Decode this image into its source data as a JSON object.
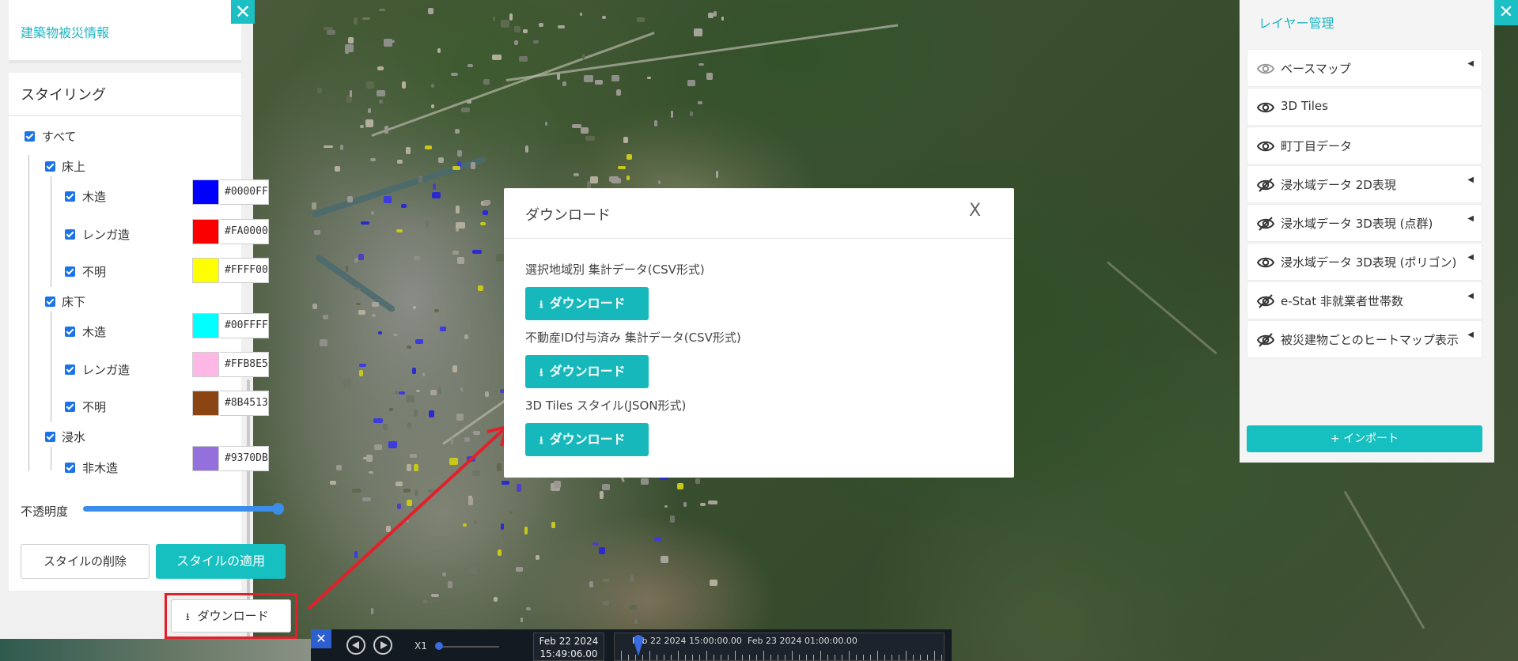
{
  "left_panel": {
    "title": "建築物被災情報",
    "close_symbol": "✕",
    "styling": {
      "title": "スタイリング",
      "all_label": "すべて",
      "groups": [
        {
          "label": "床上",
          "items": [
            {
              "label": "木造",
              "color": "#0000FF"
            },
            {
              "label": "レンガ造",
              "color": "#FA0000"
            },
            {
              "label": "不明",
              "color": "#FFFF00"
            }
          ]
        },
        {
          "label": "床下",
          "items": [
            {
              "label": "木造",
              "color": "#00FFFF"
            },
            {
              "label": "レンガ造",
              "color": "#FFB8E5"
            },
            {
              "label": "不明",
              "color": "#8B4513"
            }
          ]
        },
        {
          "label": "浸水",
          "items": [
            {
              "label": "非木造",
              "color": "#9370DB"
            }
          ]
        }
      ],
      "opacity_label": "不透明度",
      "opacity_value": 1.0,
      "delete_button": "スタイルの削除",
      "apply_button": "スタイルの適用"
    },
    "download_button": "ダウンロード"
  },
  "modal": {
    "title": "ダウンロード",
    "close_symbol": "X",
    "sections": [
      {
        "label": "選択地域別 集計データ(CSV形式)",
        "button": "ダウンロード"
      },
      {
        "label": "不動産ID付与済み 集計データ(CSV形式)",
        "button": "ダウンロード"
      },
      {
        "label": "3D Tiles スタイル(JSON形式)",
        "button": "ダウンロード"
      }
    ]
  },
  "layer_panel": {
    "title": "レイヤー管理",
    "close_symbol": "✕",
    "layers": [
      {
        "label": "ベースマップ",
        "visibility": "dimmed",
        "expandable": true
      },
      {
        "label": "3D Tiles",
        "visibility": "visible",
        "expandable": false
      },
      {
        "label": "町丁目データ",
        "visibility": "visible",
        "expandable": false
      },
      {
        "label": "浸水域データ 2D表現",
        "visibility": "hidden",
        "expandable": true
      },
      {
        "label": "浸水域データ 3D表現 (点群)",
        "visibility": "hidden",
        "expandable": true
      },
      {
        "label": "浸水域データ 3D表現 (ポリゴン)",
        "visibility": "visible",
        "expandable": true
      },
      {
        "label": "e-Stat 非就業者世帯数",
        "visibility": "hidden",
        "expandable": true
      },
      {
        "label": "被災建物ごとのヒートマップ表示",
        "visibility": "hidden",
        "expandable": true
      }
    ],
    "import_button": "+ インポート"
  },
  "timeline": {
    "close_symbol": "✕",
    "speed": "X1",
    "clock_date": "Feb 22 2024",
    "clock_time": "15:49:06.00",
    "track_start_label": "Feb 22 2024 15:00:00.00",
    "track_mid_label": "Feb 23 2024 01:00:00.00"
  },
  "colors": {
    "accent": "#17C0C0",
    "annotation_red": "#E3202A",
    "checkbox_blue": "#1A73E8"
  }
}
